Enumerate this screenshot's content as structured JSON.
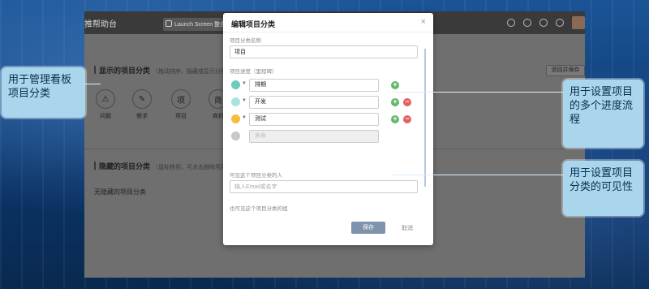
{
  "app": {
    "title": "推帮助台",
    "tab_label": "Launch Screen 整合",
    "header_button": "退回并保存",
    "shown_section": {
      "title": "显示的项目分类",
      "hint": "（拖动排序、隐藏或显示分类"
    },
    "board_items": [
      {
        "label": "问题",
        "glyph": "⚠"
      },
      {
        "label": "需求",
        "glyph": "✎"
      },
      {
        "label": "项目",
        "glyph": "项"
      },
      {
        "label": "商机",
        "glyph": "商"
      }
    ],
    "hidden_section": {
      "title": "隐藏的项目分类",
      "hint": "（鼠标移到，可点击删除项目分",
      "empty_text": "无隐藏的项目分类"
    }
  },
  "modal": {
    "title": "编辑项目分类",
    "close_glyph": "×",
    "name_label": "项目分类名称",
    "name_value": "项目",
    "stages_label": "项目进度（里程碑）",
    "stages": [
      {
        "value": "排期",
        "color": "#6ccabf",
        "buttons": [
          "plus"
        ]
      },
      {
        "value": "开发",
        "color": "#a8e3df",
        "buttons": [
          "plus",
          "minus"
        ]
      },
      {
        "value": "测试",
        "color": "#f4bd3c",
        "buttons": [
          "plus",
          "minus"
        ]
      },
      {
        "value": "",
        "placeholder": "未命",
        "color": "#c8c8c8",
        "buttons": []
      }
    ],
    "visible_label": "可见这个项目分类的人",
    "visible_placeholder": "输入Email或名字",
    "group_label": "也可见这个项目分类的组",
    "save_label": "保存",
    "cancel_label": "取消"
  },
  "callouts": {
    "left": "用于管理看板项目分类",
    "right_top": "用于设置项目的多个进度流程",
    "right_bottom": "用于设置项目分类的可见性"
  }
}
